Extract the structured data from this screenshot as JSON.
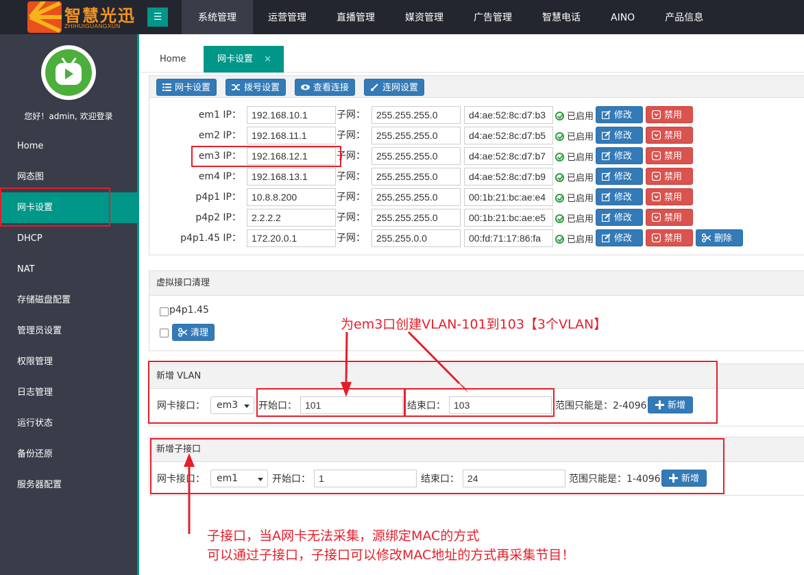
{
  "brand": {
    "name": "智慧光迅",
    "subtitle": "ZHIHUIGUANGXUN",
    "brand_color": "#f7931e"
  },
  "header": {
    "menu_toggle_icon": "indent-icon",
    "nav": [
      "系统管理",
      "运营管理",
      "直播管理",
      "媒资管理",
      "广告管理",
      "智慧电话",
      "AINO",
      "产品信息"
    ]
  },
  "sidebar": {
    "welcome": "您好！admin, 欢迎登录",
    "items": [
      "Home",
      "网态图",
      "网卡设置",
      "DHCP",
      "NAT",
      "存储磁盘配置",
      "管理员设置",
      "权限管理",
      "日志管理",
      "运行状态",
      "备份还原",
      "服务器配置"
    ],
    "active_color": "#009688"
  },
  "tabs": {
    "home": "Home",
    "current": "网卡设置",
    "close": "×"
  },
  "toolbar": [
    "网卡设置",
    "拨号设置",
    "查看连接",
    "连网设置"
  ],
  "nic": {
    "subnet_label": "子网：",
    "status_text": "已启用",
    "edit_label": "修改",
    "disable_label": "禁用",
    "delete_label": "删除",
    "rows": [
      {
        "label": "em1 IP：",
        "ip": "192.168.10.1",
        "mask": "255.255.255.0",
        "mac": "d4:ae:52:8c:d7:b3"
      },
      {
        "label": "em2 IP：",
        "ip": "192.168.11.1",
        "mask": "255.255.255.0",
        "mac": "d4:ae:52:8c:d7:b5"
      },
      {
        "label": "em3 IP：",
        "ip": "192.168.12.1",
        "mask": "255.255.255.0",
        "mac": "d4:ae:52:8c:d7:b7"
      },
      {
        "label": "em4 IP：",
        "ip": "192.168.13.1",
        "mask": "255.255.255.0",
        "mac": "d4:ae:52:8c:d7:b9"
      },
      {
        "label": "p4p1 IP：",
        "ip": "10.8.8.200",
        "mask": "255.255.255.0",
        "mac": "00:1b:21:bc:ae:e4"
      },
      {
        "label": "p4p2 IP：",
        "ip": "2.2.2.2",
        "mask": "255.255.255.0",
        "mac": "00:1b:21:bc:ae:e5"
      },
      {
        "label": "p4p1.45 IP：",
        "ip": "172.20.0.1",
        "mask": "255.255.0.0",
        "mac": "00:fd:71:17:86:fa"
      }
    ]
  },
  "virtual": {
    "title": "虚拟接口清理",
    "item": "p4p1.45",
    "clean_label": "清理"
  },
  "vlan": {
    "title": "新增 VLAN",
    "nic_label": "网卡接口：",
    "nic_value": "em3",
    "start_label": "开始口：",
    "start_value": "101",
    "end_label": "结束口：",
    "end_value": "103",
    "range": "范围只能是：2-4096",
    "add_label": "新增"
  },
  "subif": {
    "title": "新增子接口",
    "nic_label": "网卡接口：",
    "nic_value": "em1",
    "start_label": "开始口：",
    "start_value": "1",
    "end_label": "结束口：",
    "end_value": "24",
    "range": "范围只能是：1-4096",
    "add_label": "新增"
  },
  "annotations": {
    "vlan_note": "为em3口创建VLAN-101到103【3个VLAN】",
    "sub_note_1": "子接口，当A网卡无法采集，源绑定MAC的方式",
    "sub_note_2": "可以通过子接口，子接口可以修改MAC地址的方式再采集节目！",
    "color": "#e51e2a"
  }
}
